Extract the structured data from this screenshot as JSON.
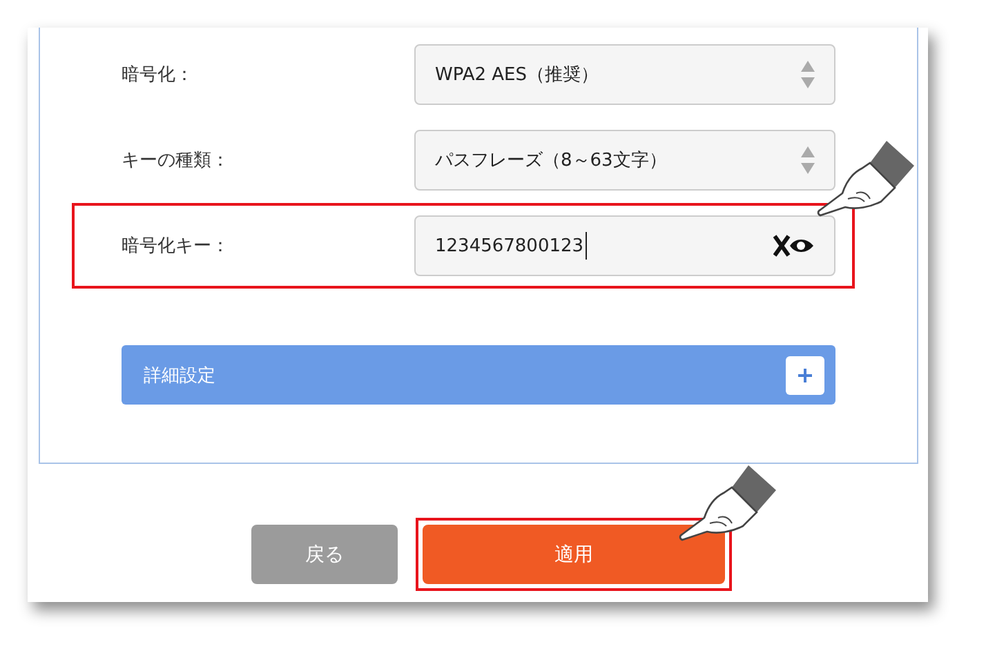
{
  "settings": [
    {
      "kind": "select",
      "label": "暗号化：",
      "value": "WPA2 AES（推奨）",
      "highlighted": false
    },
    {
      "kind": "select",
      "label": "キーの種類：",
      "value": "パスフレーズ（8～63文字）",
      "highlighted": false
    },
    {
      "kind": "password",
      "label": "暗号化キー：",
      "value": "1234567800123",
      "highlighted": true
    }
  ],
  "advanced": {
    "label": "詳細設定",
    "expanded": false
  },
  "buttons": [
    {
      "kind": "back",
      "label": "戻る",
      "highlighted": false
    },
    {
      "kind": "apply",
      "label": "適用",
      "highlighted": true
    }
  ]
}
